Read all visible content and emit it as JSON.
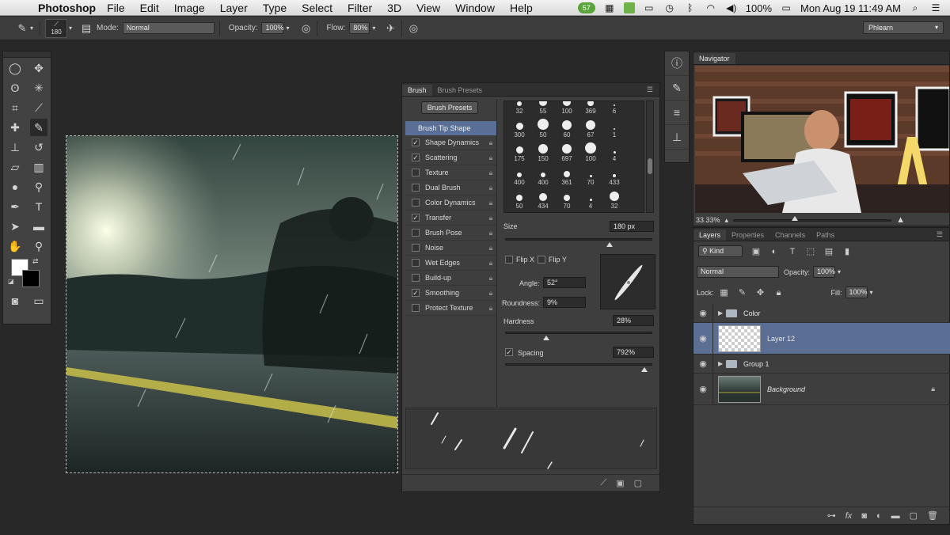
{
  "menubar": {
    "app_name": "Photoshop",
    "items": [
      "File",
      "Edit",
      "Image",
      "Layer",
      "Type",
      "Select",
      "Filter",
      "3D",
      "View",
      "Window",
      "Help"
    ],
    "status": {
      "badge": "57",
      "battery": "100%",
      "clock": "Mon Aug 19  11:49 AM"
    }
  },
  "options_bar": {
    "brush_size": "180",
    "mode_label": "Mode:",
    "mode_value": "Normal",
    "opacity_label": "Opacity:",
    "opacity_value": "100%",
    "flow_label": "Flow:",
    "flow_value": "80%",
    "workspace": "Phlearn"
  },
  "brush_panel": {
    "tabs": [
      "Brush",
      "Brush Presets"
    ],
    "presets_button": "Brush Presets",
    "tip_shape_label": "Brush Tip Shape",
    "options": [
      {
        "label": "Shape Dynamics",
        "checked": true
      },
      {
        "label": "Scattering",
        "checked": true
      },
      {
        "label": "Texture",
        "checked": false
      },
      {
        "label": "Dual Brush",
        "checked": false
      },
      {
        "label": "Color Dynamics",
        "checked": false
      },
      {
        "label": "Transfer",
        "checked": true
      },
      {
        "label": "Brush Pose",
        "checked": false
      },
      {
        "label": "Noise",
        "checked": false
      },
      {
        "label": "Wet Edges",
        "checked": false
      },
      {
        "label": "Build-up",
        "checked": false
      },
      {
        "label": "Smoothing",
        "checked": true
      },
      {
        "label": "Protect Texture",
        "checked": false
      }
    ],
    "tip_sizes": [
      "32",
      "55",
      "100",
      "369",
      "6",
      "300",
      "50",
      "60",
      "67",
      "1",
      "175",
      "150",
      "697",
      "100",
      "4",
      "400",
      "400",
      "361",
      "70",
      "433",
      "50",
      "434",
      "70",
      "4",
      "32"
    ],
    "size_label": "Size",
    "size_value": "180 px",
    "flip_x": "Flip X",
    "flip_y": "Flip Y",
    "angle_label": "Angle:",
    "angle_value": "52°",
    "roundness_label": "Roundness:",
    "roundness_value": "9%",
    "hardness_label": "Hardness",
    "hardness_value": "28%",
    "spacing_label": "Spacing",
    "spacing_value": "792%"
  },
  "navigator": {
    "tab": "Navigator",
    "zoom": "33.33%"
  },
  "layers_panel": {
    "tabs": [
      "Layers",
      "Properties",
      "Channels",
      "Paths"
    ],
    "kind_filter": "Kind",
    "blend_mode": "Normal",
    "opacity_label": "Opacity:",
    "opacity_value": "100%",
    "lock_label": "Lock:",
    "fill_label": "Fill:",
    "fill_value": "100%",
    "layers": [
      {
        "name": "Color",
        "type": "group"
      },
      {
        "name": "Layer 12",
        "type": "layer",
        "selected": true
      },
      {
        "name": "Group 1",
        "type": "group"
      },
      {
        "name": "Background",
        "type": "background"
      }
    ]
  },
  "colors": {
    "selection": "#5a6f96",
    "panel": "#3e3e3e"
  }
}
